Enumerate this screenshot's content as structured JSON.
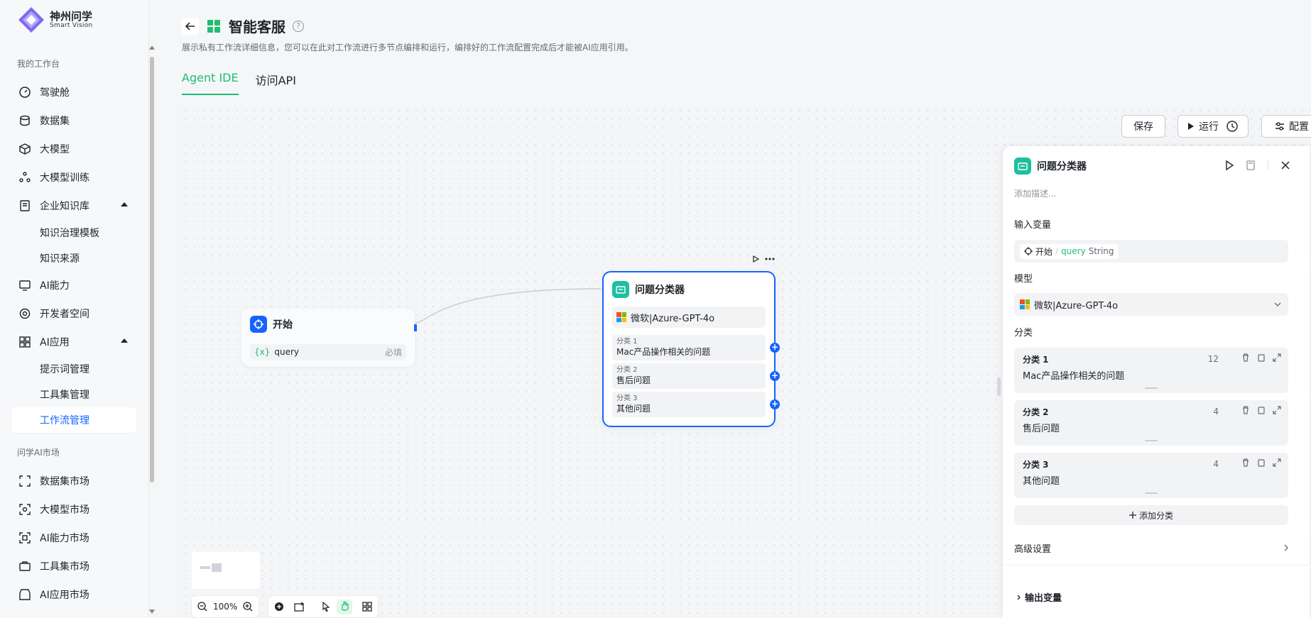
{
  "brand": {
    "title": "神州问学",
    "subtitle": "Smart Vision"
  },
  "sidebar": {
    "group_workspace": "我的工作台",
    "cockpit": "驾驶舱",
    "dataset": "数据集",
    "llm": "大模型",
    "llm_train": "大模型训练",
    "kb": "企业知识库",
    "kb_template": "知识治理模板",
    "kb_source": "知识来源",
    "ai_ability": "AI能力",
    "dev_space": "开发者空间",
    "ai_app": "AI应用",
    "prompt_mgmt": "提示词管理",
    "toolset_mgmt": "工具集管理",
    "workflow_mgmt": "工作流管理",
    "group_market": "问学AI市场",
    "dataset_market": "数据集市场",
    "llm_market": "大模型市场",
    "ability_market": "AI能力市场",
    "toolset_market": "工具集市场",
    "app_market": "AI应用市场"
  },
  "header": {
    "title": "智能客服",
    "desc": "展示私有工作流详细信息，您可以在此对工作流进行多节点编排和运行，编排好的工作流配置完成后才能被AI应用引用。",
    "help": "?"
  },
  "tabs": {
    "ide": "Agent IDE",
    "api": "访问API"
  },
  "toolbar": {
    "save": "保存",
    "run": "运行",
    "config": "配置"
  },
  "start_node": {
    "title": "开始",
    "var_icon": "{x}",
    "var_name": "query",
    "required": "必填"
  },
  "cls_node": {
    "title": "问题分类器",
    "model": "微软|Azure-GPT-4o",
    "items": [
      {
        "label": "分类 1",
        "text": "Mac产品操作相关的问题"
      },
      {
        "label": "分类 2",
        "text": "售后问题"
      },
      {
        "label": "分类 3",
        "text": "其他问题"
      }
    ]
  },
  "panel": {
    "title": "问题分类器",
    "desc_placeholder": "添加描述...",
    "input_label": "输入变量",
    "input_src": "开始",
    "input_sep": "/",
    "input_var": "query",
    "input_type": "String",
    "model_label": "模型",
    "model": "微软|Azure-GPT-4o",
    "cls_label": "分类",
    "items": [
      {
        "label": "分类 1",
        "text": "Mac产品操作相关的问题",
        "count": "12"
      },
      {
        "label": "分类 2",
        "text": "售后问题",
        "count": "4"
      },
      {
        "label": "分类 3",
        "text": "其他问题",
        "count": "4"
      }
    ],
    "add_cls": "添加分类",
    "advanced": "高级设置",
    "output": "输出变量"
  },
  "zoom": {
    "value": "100%"
  },
  "colors": {
    "accent": "#1dbf73",
    "primary": "#1664ff",
    "danger": "#f54a45"
  }
}
